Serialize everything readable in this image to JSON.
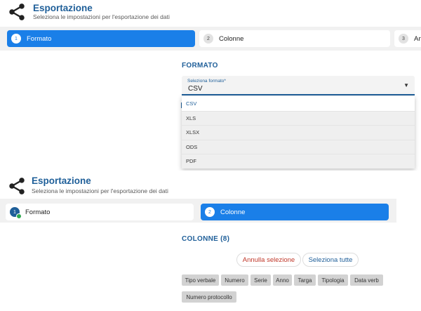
{
  "header": {
    "title": "Esportazione",
    "subtitle": "Seleziona le impostazioni per l'esportazione dei dati",
    "icon": "share-icon"
  },
  "top_stepper": {
    "steps": [
      {
        "number": "1",
        "label": "Formato",
        "active": true
      },
      {
        "number": "2",
        "label": "Colonne",
        "active": false
      },
      {
        "number": "3",
        "label": "An",
        "active": false
      }
    ]
  },
  "bottom_stepper": {
    "steps": [
      {
        "number": "1",
        "label": "Formato",
        "active": false,
        "completed": true
      },
      {
        "number": "2",
        "label": "Colonne",
        "active": true
      }
    ]
  },
  "formato": {
    "title": "FORMATO",
    "select_label": "Seleziona formato*",
    "select_value": "CSV",
    "options": [
      "CSV",
      "XLS",
      "XLSX",
      "ODS",
      "PDF"
    ]
  },
  "colonne": {
    "title": "COLONNE (8)",
    "deselect_label": "Annulla selezione",
    "select_all_label": "Seleziona tutte",
    "columns": [
      "Tipo verbale",
      "Numero",
      "Serie",
      "Anno",
      "Targa",
      "Tipologia",
      "Data verb",
      "Numero protocollo"
    ]
  },
  "colors": {
    "primary": "#1f5f99",
    "active_step": "#1a7fe8",
    "danger": "#c0392b",
    "success": "#2fa84f"
  }
}
